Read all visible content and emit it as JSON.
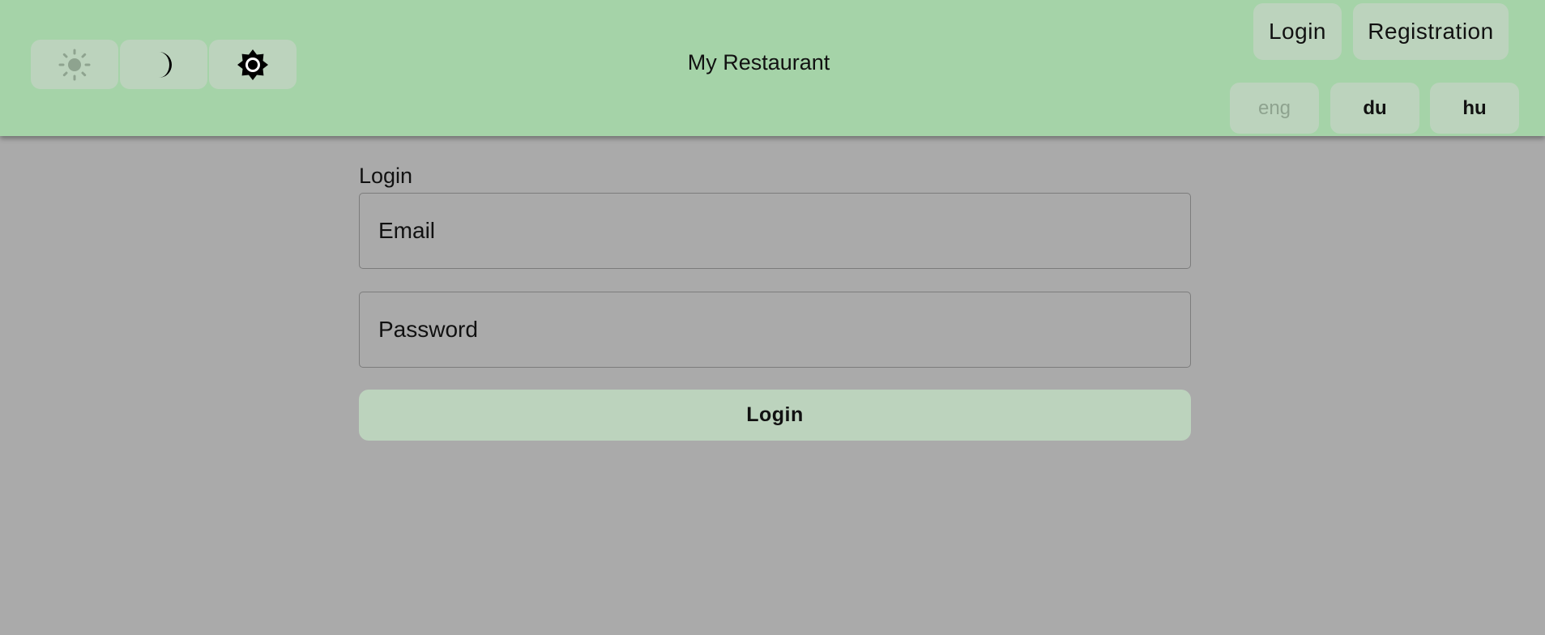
{
  "header": {
    "title": "My Restaurant",
    "background_color": "#a5d3a8",
    "theme_buttons": [
      {
        "icon": "sun-icon",
        "state": "disabled"
      },
      {
        "icon": "moon-icon",
        "state": "enabled"
      },
      {
        "icon": "brightness-auto-icon",
        "state": "enabled"
      }
    ],
    "nav": {
      "login_label": "Login",
      "registration_label": "Registration"
    },
    "languages": [
      {
        "label": "eng",
        "state": "disabled"
      },
      {
        "label": "du",
        "state": "enabled"
      },
      {
        "label": "hu",
        "state": "enabled"
      }
    ]
  },
  "login_form": {
    "title": "Login",
    "email_placeholder": "Email",
    "password_placeholder": "Password",
    "submit_label": "Login"
  },
  "colors": {
    "background": "#aaaaaa",
    "button": "#bcd3bd"
  }
}
